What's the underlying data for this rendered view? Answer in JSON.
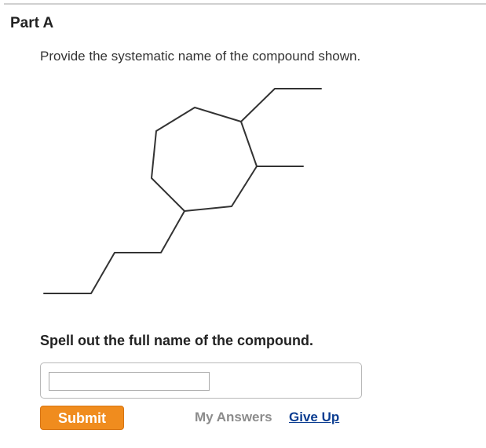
{
  "part": {
    "title": "Part A"
  },
  "question": {
    "prompt": "Provide the systematic name of the compound shown."
  },
  "structure": {
    "line_color": "#333333"
  },
  "answer": {
    "instruction": "Spell out the full name of the compound.",
    "input_value": "",
    "input_placeholder": ""
  },
  "actions": {
    "submit_label": "Submit",
    "my_answers_label": "My Answers",
    "give_up_label": "Give Up"
  },
  "colors": {
    "submit_bg": "#f08c1e",
    "link_blue": "#0b3d91",
    "muted_gray": "#8c8c8c"
  }
}
